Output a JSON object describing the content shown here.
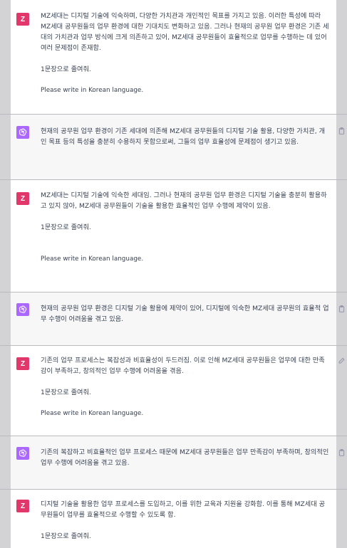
{
  "messages": [
    {
      "role": "user",
      "avatar": "Z",
      "paragraphs": [
        "MZ세대는 디지털 기술에 익숙하며, 다양한 가치관과 개인적인 목표를 가지고 있음. 이러한 특성에 따라 MZ세대 공무원들의 업무 환경에 대한 기대치도 변화하고 있음. 그러나 현재의 공무원 업무 환경은 기존 세대의 가치관과 업무 방식에 크게 의존하고 있어, MZ세대 공무원들이 효율적으로 업무를 수행하는 데 있어 여러 문제점이 존재함.",
        "1문장으로 줄여줘.",
        "Please write in Korean language."
      ]
    },
    {
      "role": "assistant",
      "paragraphs": [
        "현재의 공무원 업무 환경이 기존 세대에 의존해 MZ세대 공무원들의 디지털 기술 활용, 다양한 가치관, 개인 목표 등의 특성을 충분히 수용하지 못함으로써, 그들의 업무 효율성에 문제점이 생기고 있음."
      ]
    },
    {
      "role": "user",
      "avatar": "Z",
      "paragraphs": [
        " MZ세대는 디지털 기술에 익숙한 세대임. 그러나 현재의 공무원 업무 환경은 디지털 기술을 충분히 활용하고 있지 않아, MZ세대 공무원들이 기술을 활용한 효율적인 업무 수행에 제약이 있음.",
        "1문장으로 줄여줘.",
        "Please write in Korean language."
      ]
    },
    {
      "role": "assistant",
      "paragraphs": [
        "현재의 공무원 업무 환경은 디지털 기술 활용에 제약이 있어, 디지털에 익숙한 MZ세대 공무원의 효율적 업무 수행이 어려움을 겪고 있음."
      ]
    },
    {
      "role": "user",
      "avatar": "Z",
      "paragraphs": [
        "기존의 업무 프로세스는 복잡성과 비효율성이 두드러짐. 이로 인해 MZ세대 공무원들은 업무에 대한 만족감이 부족하고, 창의적인 업무 수행에 어려움을 겪음.",
        "1문장으로 줄여줘.",
        "Please write in Korean language."
      ]
    },
    {
      "role": "assistant",
      "paragraphs": [
        "기존의 복잡하고 비효율적인 업무 프로세스 때문에 MZ세대 공무원들은 업무 만족감이 부족하며, 창의적인 업무 수행에 어려움을 겪고 있음."
      ]
    },
    {
      "role": "user",
      "avatar": "Z",
      "paragraphs": [
        "디지털 기술을 활용한 업무 프로세스를 도입하고, 이를 위한 교육과 지원을 강화함. 이를 통해 MZ세대 공무원들이 업무를 효율적으로 수행할 수 있도록 함.",
        "1문장으로 줄여줘."
      ]
    }
  ],
  "icons": {
    "assistant_avatar": "openai-logo-icon",
    "copy": "clipboard-icon",
    "edit": "pencil-icon"
  },
  "colors": {
    "user_avatar": "#e2376a",
    "assistant_avatar": "#ab68ff",
    "assistant_bg": "#f7f7f8",
    "page_bg": "#d3d3d6"
  }
}
